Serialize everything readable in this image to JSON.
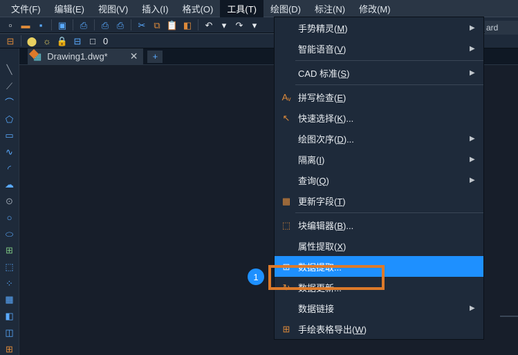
{
  "menubar": [
    {
      "label": "文件(F)"
    },
    {
      "label": "编辑(E)"
    },
    {
      "label": "视图(V)"
    },
    {
      "label": "插入(I)"
    },
    {
      "label": "格式(O)"
    },
    {
      "label": "工具(T)",
      "active": true
    },
    {
      "label": "绘图(D)"
    },
    {
      "label": "标注(N)"
    },
    {
      "label": "修改(M)"
    }
  ],
  "tab": {
    "filename": "Drawing1.dwg*"
  },
  "rfrag": "ard",
  "callout": "1",
  "tb2_value": "0",
  "dropdown": [
    {
      "label": "手势精灵(M)",
      "u": "M",
      "arrow": true
    },
    {
      "label": "智能语音(V)",
      "u": "V",
      "arrow": true
    },
    {
      "type": "div"
    },
    {
      "label": "CAD 标准(S)",
      "u": "S",
      "arrow": true
    },
    {
      "type": "div"
    },
    {
      "label": "拼写检查(E)",
      "u": "E",
      "icon": "spell"
    },
    {
      "label": "快速选择(K)...",
      "u": "K",
      "icon": "qsel"
    },
    {
      "label": "绘图次序(D)...",
      "u": "D",
      "arrow": true
    },
    {
      "label": "隔离(I)",
      "u": "I",
      "arrow": true
    },
    {
      "label": "查询(Q)",
      "u": "Q",
      "arrow": true
    },
    {
      "label": "更新字段(T)",
      "u": "T",
      "icon": "upd"
    },
    {
      "type": "div"
    },
    {
      "label": "块编辑器(B)...",
      "u": "B",
      "icon": "blk"
    },
    {
      "label": "属性提取(X)",
      "u": "X"
    },
    {
      "label": "数据提取...",
      "icon": "ext",
      "sel": true
    },
    {
      "label": "数据更新...",
      "icon": "ref"
    },
    {
      "label": "数据链接",
      "arrow": true
    },
    {
      "label": "手绘表格导出(W)",
      "u": "W",
      "icon": "tbl"
    }
  ]
}
